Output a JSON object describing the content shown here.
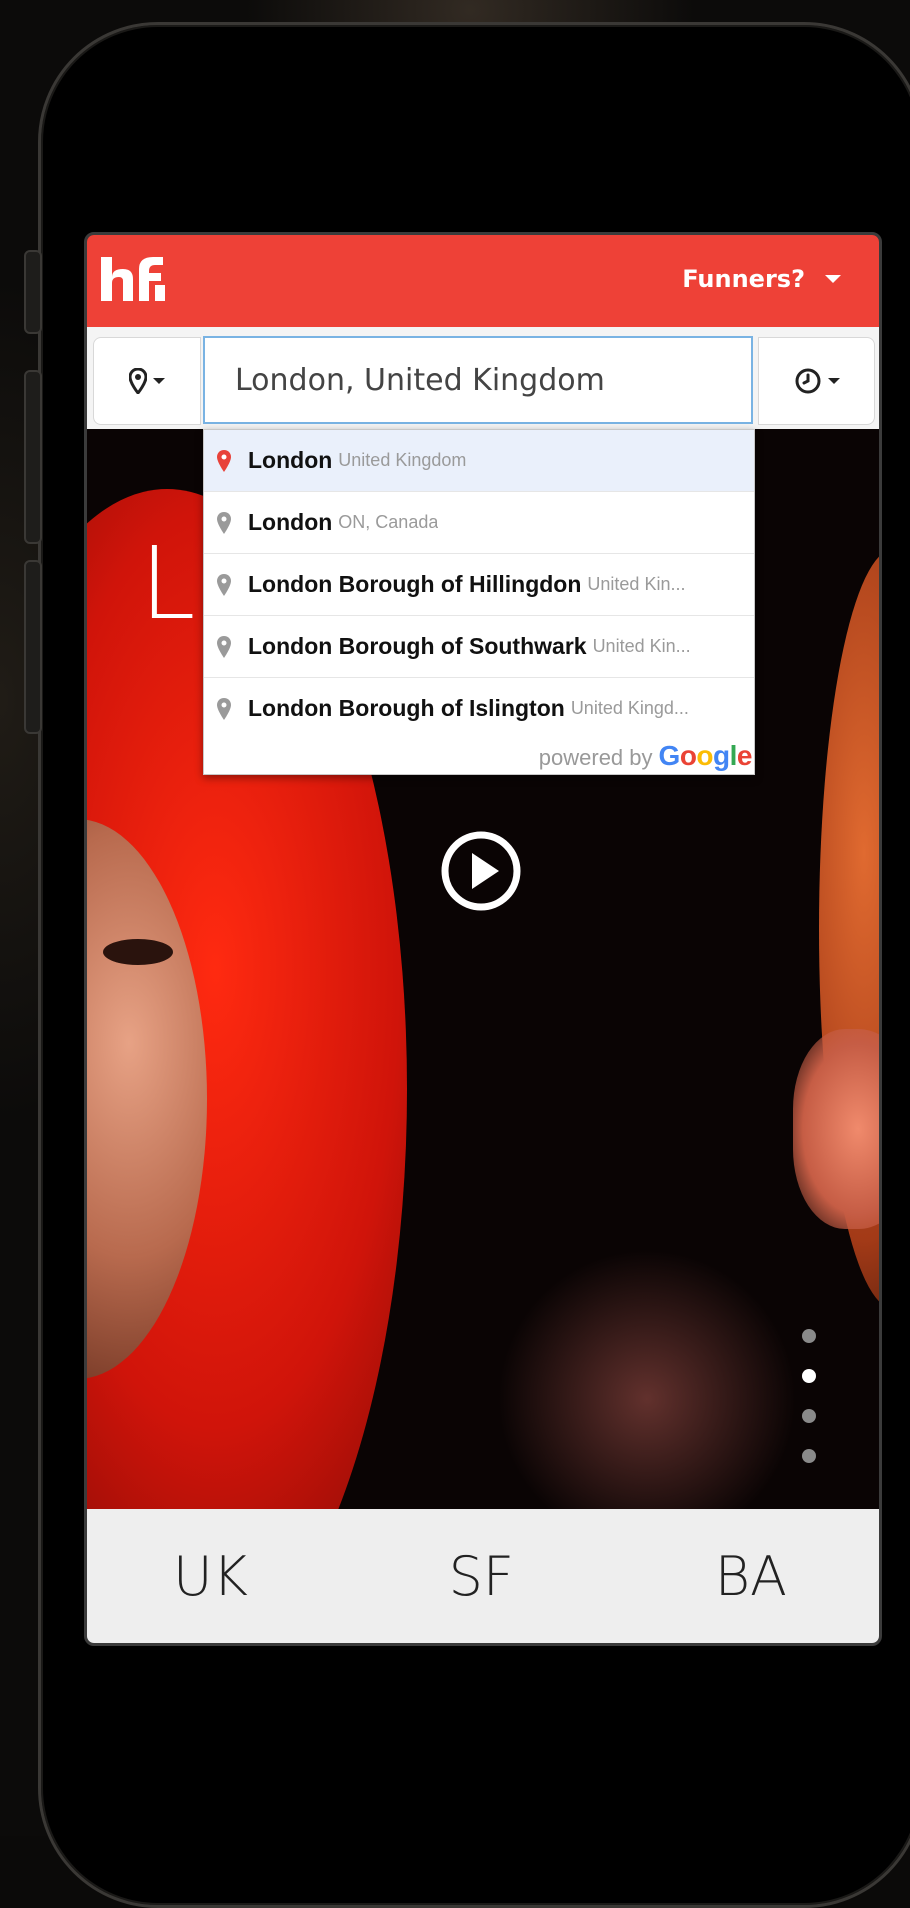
{
  "header": {
    "logo_text": "hf",
    "user_menu_label": "Funners?"
  },
  "search": {
    "value": "London, United Kingdom",
    "location_icon": "map-pin-icon",
    "time_icon": "clock-icon"
  },
  "suggestions": [
    {
      "main": "London",
      "rest": "",
      "secondary": "United Kingdom"
    },
    {
      "main": "London",
      "rest": "",
      "secondary": "ON, Canada"
    },
    {
      "main": "London",
      "rest": " Borough of Hillingdon",
      "secondary": "United Kin..."
    },
    {
      "main": "London",
      "rest": " Borough of Southwark",
      "secondary": "United Kin..."
    },
    {
      "main": "London",
      "rest": " Borough of Islington",
      "secondary": "United Kingd..."
    }
  ],
  "powered_by": {
    "prefix": "powered by",
    "brand": "Google"
  },
  "hero": {
    "title": "LA"
  },
  "carousel": {
    "count": 4,
    "active_index": 1
  },
  "tabs": [
    "UK",
    "SF",
    "BA"
  ],
  "colors": {
    "brand_red": "#ee4137",
    "selected_pin": "#e8423a",
    "pin_gray": "#9a9a9a"
  }
}
